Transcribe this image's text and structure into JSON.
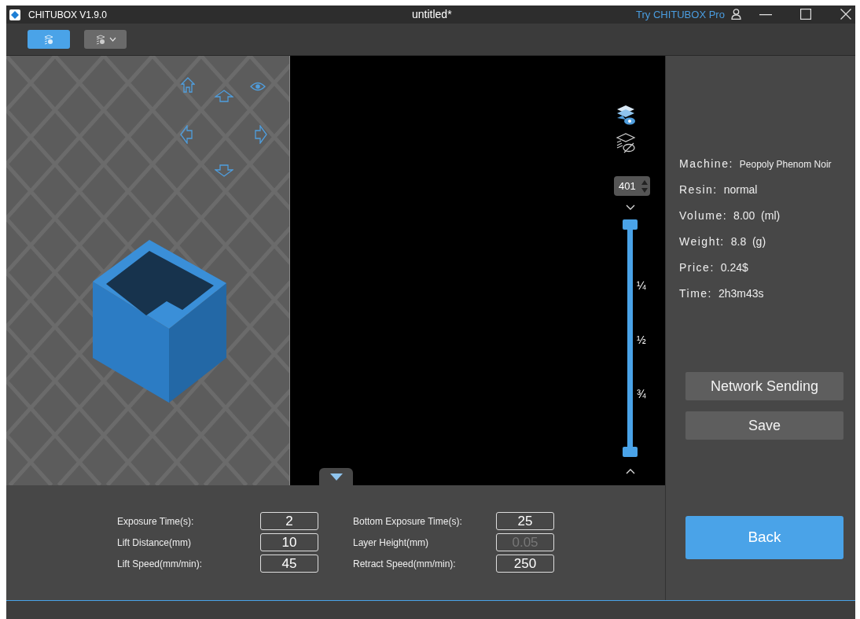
{
  "window": {
    "app_title": "CHITUBOX V1.9.0",
    "document_title": "untitled*",
    "promo_link": "Try CHITUBOX Pro"
  },
  "toolbar": {
    "buttons": [
      {
        "selected": true,
        "dropdown": false
      },
      {
        "selected": false,
        "dropdown": true
      }
    ]
  },
  "layer_slider": {
    "layer": "401",
    "level": 1,
    "ticks": [
      "¼",
      "½",
      "¾"
    ]
  },
  "info": [
    {
      "label": "Machine:",
      "value": "Peopoly Phenom Noir",
      "kind": "small"
    },
    {
      "label": "Resin:",
      "value": "normal",
      "kind": "normal"
    },
    {
      "label": "Volume:",
      "value": "8.00  (ml)",
      "kind": "normal"
    },
    {
      "label": "Weight:",
      "value": "8.8  (g)",
      "kind": "normal"
    },
    {
      "label": "Price:",
      "value": "0.24$",
      "kind": "normal"
    },
    {
      "label": "Time:",
      "value": "2h3m43s",
      "kind": "normal"
    }
  ],
  "actions": [
    "Network Sending",
    "Save"
  ],
  "back_button": "Back",
  "parameters": [
    {
      "label": "Exposure Time(s):",
      "value": "2",
      "disabled": false
    },
    {
      "label": "Bottom Exposure Time(s):",
      "value": "25",
      "disabled": false
    },
    {
      "label": "Lift Distance(mm)",
      "value": "10",
      "disabled": false
    },
    {
      "label": "Layer Height(mm)",
      "value": "0.05",
      "disabled": true
    },
    {
      "label": "Lift Speed(mm/min):",
      "value": "45",
      "disabled": false
    },
    {
      "label": "Retract Speed(mm/min):",
      "value": "250",
      "disabled": false
    }
  ]
}
